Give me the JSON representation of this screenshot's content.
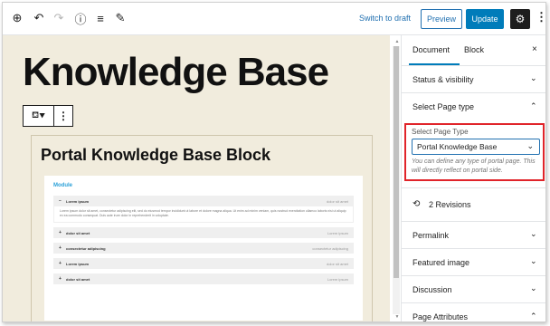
{
  "toolbar": {
    "icons": [
      "add-icon",
      "undo-icon",
      "redo-icon",
      "info-icon",
      "list-view-icon",
      "edit-icon"
    ],
    "switch_to_draft": "Switch to draft",
    "preview": "Preview",
    "update": "Update",
    "settings_icon": "gear-icon",
    "more_icon": "more-vertical-icon"
  },
  "editor": {
    "page_title": "Knowledge Base",
    "block_title": "Portal Knowledge Base Block",
    "kb": {
      "module": "Module",
      "items": [
        {
          "symbol": "−",
          "title": "Lorem ipsum",
          "right": "dolor sit amet",
          "expanded": true,
          "text": "Lorem ipsum dolor sit amet, consectetur adipiscing elit, sed do eiusmod tempor incididunt ut labore et dolore magna aliqua. Ut enim ad minim veniam, quis nostrud exercitation ullamco laboris nisi ut aliquip ex ea commodo consequat. Duis aute irure dolor in reprehenderit in voluptate."
        },
        {
          "symbol": "+",
          "title": "dolor sit amet",
          "right": "Lorem ipsum"
        },
        {
          "symbol": "+",
          "title": "consectetur adipiscing",
          "right": "consectetur adipiscing"
        },
        {
          "symbol": "+",
          "title": "Lorem ipsum",
          "right": "dolor sit amet"
        },
        {
          "symbol": "+",
          "title": "dolor sit amet",
          "right": "Lorem ipsum"
        }
      ]
    }
  },
  "sidebar": {
    "tabs": [
      "Document",
      "Block"
    ],
    "close": "×",
    "status_visibility": "Status & visibility",
    "select_page_type_header": "Select Page type",
    "select_label": "Select Page Type",
    "select_value": "Portal Knowledge Base",
    "select_help": "You can define any type of portal page. This will directly reflect on portal side.",
    "revisions": "2 Revisions",
    "panels": [
      "Permalink",
      "Featured image",
      "Discussion",
      "Page Attributes"
    ]
  },
  "colors": {
    "accent": "#007cba",
    "highlight_border": "#e0242a",
    "canvas_bg": "#f1ecdd",
    "module_title": "#2aa0d8"
  }
}
